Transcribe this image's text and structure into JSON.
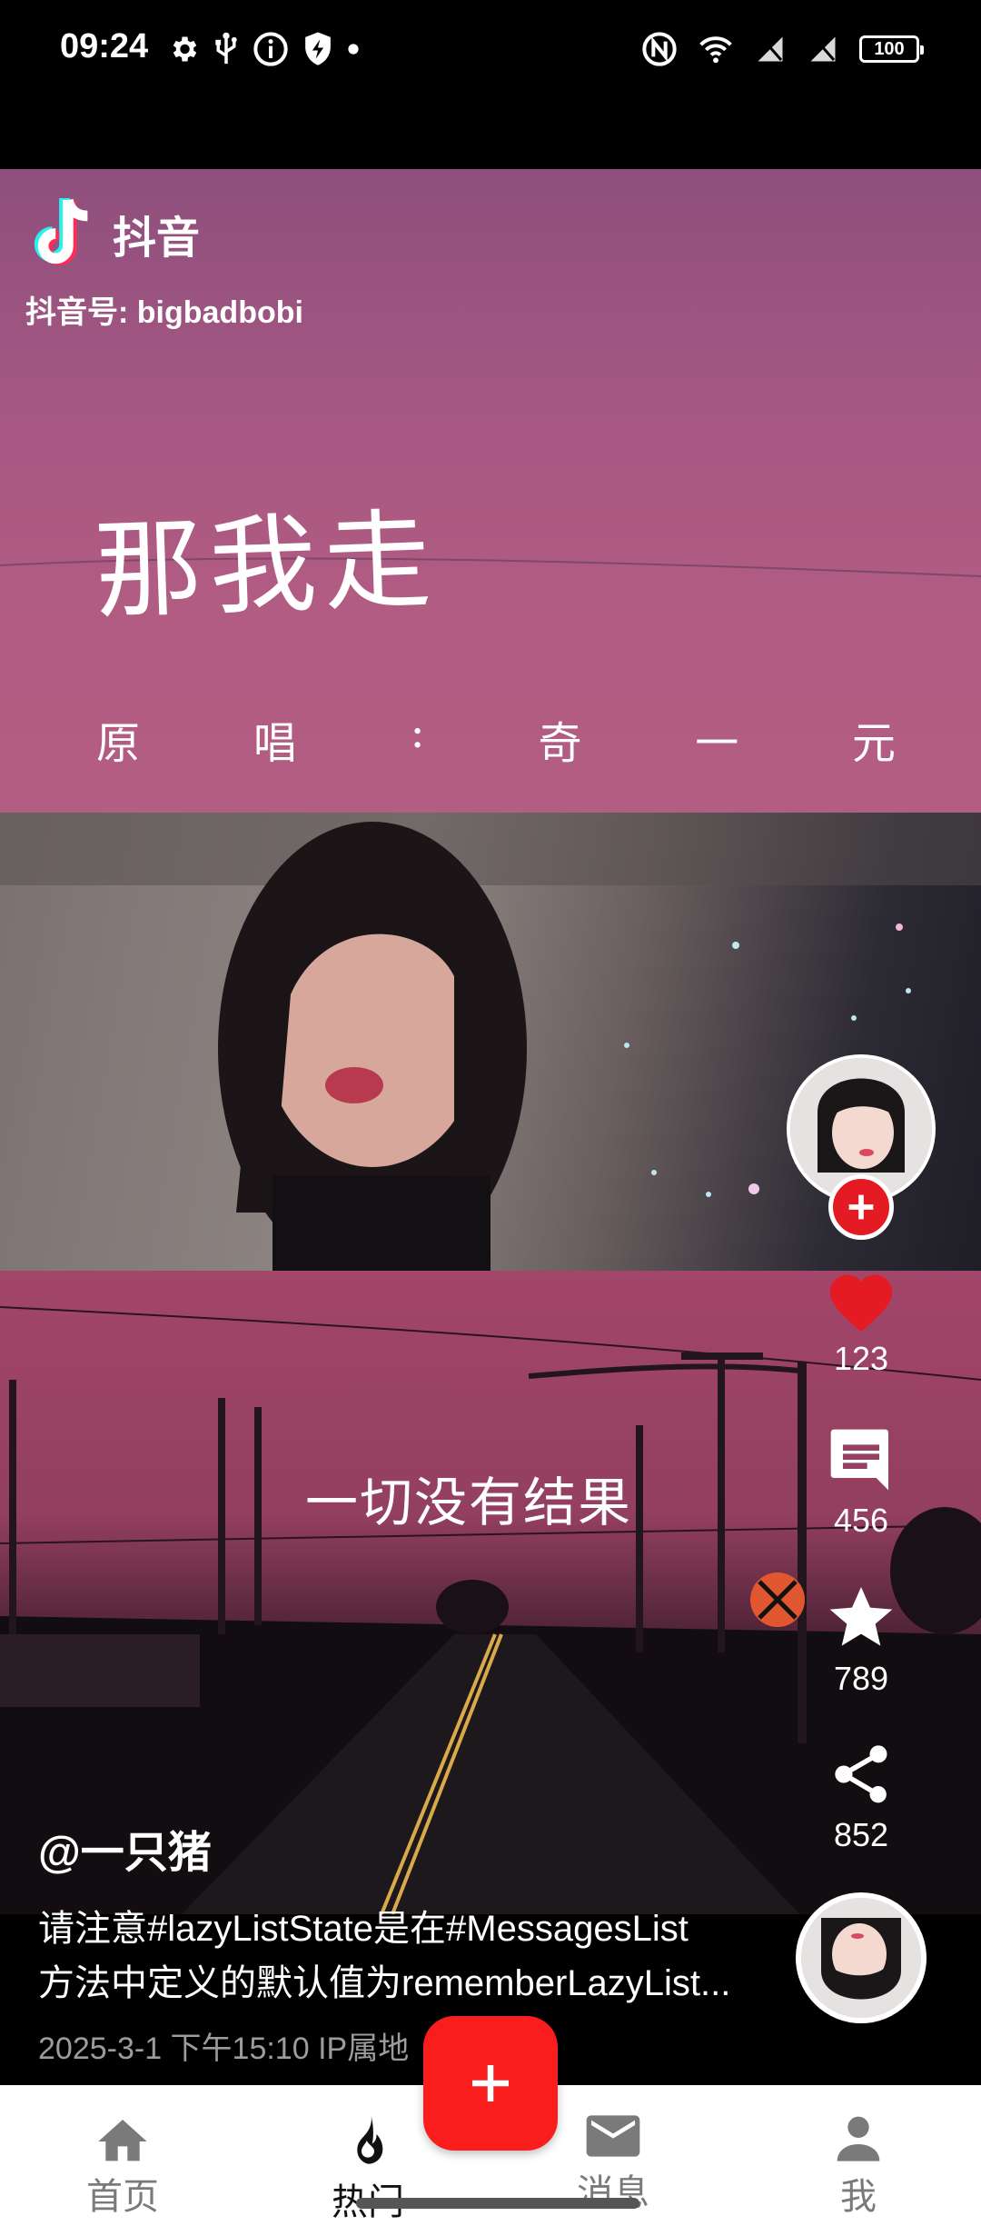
{
  "status_bar": {
    "time": "09:24",
    "battery": "100",
    "left_icons": [
      "gear-icon",
      "usb-icon",
      "info-icon",
      "shield-bolt-icon",
      "dot-icon"
    ],
    "right_icons": [
      "nfc-icon",
      "wifi-icon",
      "no-sim-icon",
      "no-sim-icon",
      "battery-icon"
    ]
  },
  "video": {
    "watermark": {
      "app_name": "抖音",
      "id_label": "抖音号: bigbadbobi"
    },
    "song_title": "那我走",
    "singer_chars": [
      "原",
      "唱",
      ":",
      "奇",
      "一",
      "元"
    ],
    "lyric": "一切没有结果"
  },
  "actions": {
    "like_count": "123",
    "comment_count": "456",
    "favorite_count": "789",
    "share_count": "852"
  },
  "post": {
    "author": "@一只猪",
    "description_line1": "请注意#lazyListState是在#MessagesList",
    "description_line2": "方法中定义的默认值为rememberLazyList...",
    "meta": "2025-3-1 下午15:10  IP属地"
  },
  "bottom_nav": {
    "items": [
      {
        "label": "首页",
        "icon": "home-icon"
      },
      {
        "label": "热门",
        "icon": "flame-icon"
      },
      {
        "label": "消息",
        "icon": "mail-icon"
      },
      {
        "label": "我",
        "icon": "person-icon"
      }
    ],
    "active_index": 1,
    "create_icon": "plus-icon"
  },
  "colors": {
    "accent_red": "#fa1d1d",
    "like_red": "#e51b24",
    "nav_active": "#111111",
    "nav_inactive": "#7a7a7a"
  }
}
